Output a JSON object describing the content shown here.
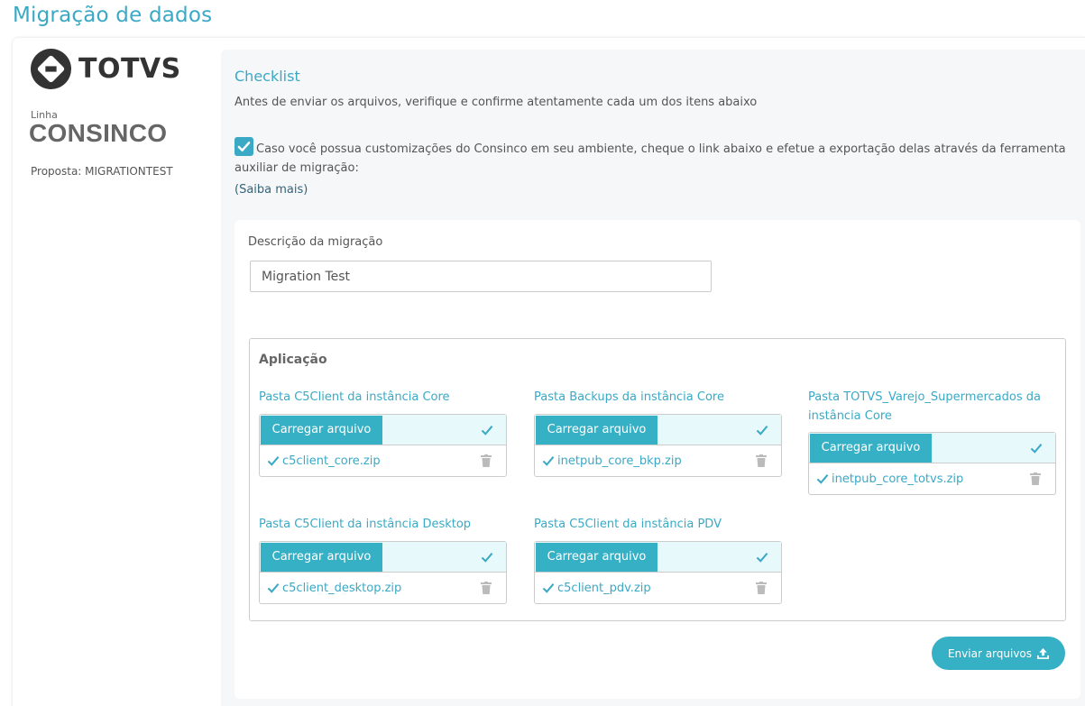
{
  "page": {
    "title": "Migração de dados"
  },
  "sidebar": {
    "logo_text": "TOTVS",
    "linha_label": "Linha",
    "product_name": "CONSINCO",
    "proposta": "Proposta: MIGRATIONTEST"
  },
  "checklist": {
    "title": "Checklist",
    "subtitle": "Antes de enviar os arquivos, verifique e confirme atentamente cada um dos itens abaixo",
    "item_text": "Caso você possua customizações do Consinco em seu ambiente, cheque o link abaixo e efetue a exportação delas através da ferramenta auxiliar de migração:",
    "item_checked": true,
    "link_text": "(Saiba mais)"
  },
  "form": {
    "description_label": "Descrição da migração",
    "description_value": "Migration Test"
  },
  "application": {
    "title": "Aplicação",
    "upload_button_label": "Carregar arquivo",
    "slots": [
      {
        "label": "Pasta C5Client da instância Core",
        "file": "c5client_core.zip"
      },
      {
        "label": "Pasta Backups da instância Core",
        "file": "inetpub_core_bkp.zip"
      },
      {
        "label": "Pasta TOTVS_Varejo_Supermercados da instância Core",
        "file": "inetpub_core_totvs.zip"
      },
      {
        "label": "Pasta C5Client da instância Desktop",
        "file": "c5client_desktop.zip"
      },
      {
        "label": "Pasta C5Client da instância PDV",
        "file": "c5client_pdv.zip"
      }
    ]
  },
  "actions": {
    "send_label": "Enviar arquivos"
  },
  "colors": {
    "accent": "#3aa9c6",
    "button": "#36b0c5",
    "upload_bg": "#e8f9fb"
  }
}
